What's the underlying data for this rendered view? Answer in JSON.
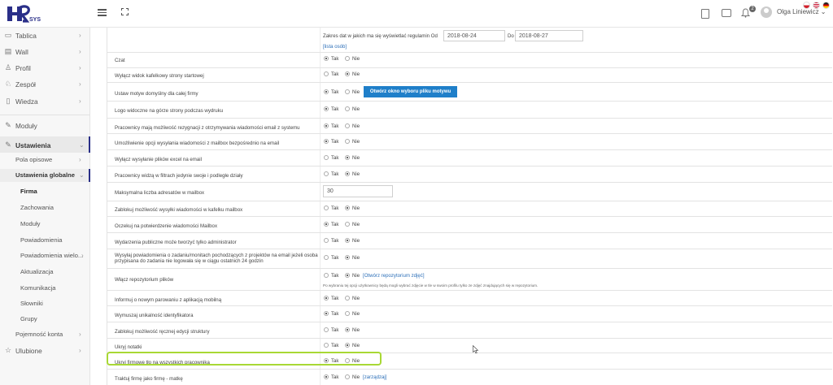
{
  "header": {
    "logo": "HR SYS",
    "user_name": "Olga Liniewicz ⌄",
    "notification_count": "2"
  },
  "sidebar": {
    "items": [
      {
        "label": "Tablica",
        "icon": "monitor-icon"
      },
      {
        "label": "Wall",
        "icon": "wall-icon"
      },
      {
        "label": "Profil",
        "icon": "user-icon"
      },
      {
        "label": "Zespół",
        "icon": "team-icon"
      },
      {
        "label": "Wiedza",
        "icon": "book-icon"
      },
      {
        "label": "Moduły",
        "icon": "wrench-icon"
      },
      {
        "label": "Ustawienia",
        "icon": "settings-icon"
      }
    ],
    "sub": {
      "pola_opisowe": "Pola opisowe",
      "ustawienia_globalne": "Ustawienia globalne",
      "firma": "Firma",
      "zachowania": "Zachowania",
      "moduly": "Moduły",
      "powiadomienia": "Powiadomienia",
      "powiadomienia_wielo": "Powiadomienia wielo...",
      "aktualizacja": "Aktualizacja",
      "komunikacja": "Komunikacja",
      "slowniki": "Słowniki",
      "grupy": "Grupy",
      "pojemnosc": "Pojemność konta",
      "ulubione": "Ulubione"
    }
  },
  "top_section": {
    "date_label": "Zakres dat w jakich ma się wyświetlać regulamin Od",
    "date_from": "2018-08-24",
    "do_label": "Do",
    "date_to": "2018-08-27",
    "lista_link": "[lista osób]"
  },
  "common": {
    "tak": "Tak",
    "nie": "Nie"
  },
  "rows": [
    {
      "label": "Czat",
      "value": "tak"
    },
    {
      "label": "Wyłącz widok kafelkowy strony startowej",
      "value": "nie"
    },
    {
      "label": "Ustaw motyw domyślny dla całej firmy",
      "value": "tak",
      "button": "Otwórz okno wyboru pliku motywu"
    },
    {
      "label": "Logo widoczne na górze strony podczas wydruku",
      "value": "tak"
    },
    {
      "label": "Pracownicy mają możliwość rezygnacji z otrzymywania wiadomości email z systemu",
      "value": "tak"
    },
    {
      "label": "Umożliwienie opcji wysyłania wiadomości z mailbox bezpośrednio na email",
      "value": "tak"
    },
    {
      "label": "Wyłącz wysyłanie plików excel na email",
      "value": "nie"
    },
    {
      "label": "Pracownicy widzą w filtrach jedynie swoje i podległe działy",
      "value": "nie"
    },
    {
      "label": "Maksymalna liczba adresatów w mailbox",
      "input": "30"
    },
    {
      "label": "Zablokuj możliwość wysyłki wiadomości w kafelku mailbox",
      "value": "nie"
    },
    {
      "label": "Oczekuj na potwierdzenie wiadomości Mailbox",
      "value": "tak"
    },
    {
      "label": "Wydarzenia publiczne może tworzyć tylko administrator",
      "value": "nie"
    },
    {
      "label": "Wysyłaj powiadomienia o zadaniu/monitach pochodzących z projektów na email jeżeli osoba",
      "label2": "przypisana do zadania nie logowała się w ciągu ostatnich 24 godzin",
      "value": "nie"
    },
    {
      "label": "Włącz repozytorium plików",
      "value": "nie",
      "link": "[Otwórz repozytorium zdjęć]",
      "note": "Po wybraniu tej opcji użytkownicy będą mogli wybrać zdjęcie w tle w swoim profilu tylko ze zdjęć znajdujących się w repozytorium."
    },
    {
      "label": "Informuj o nowym parowaniu z aplikacją mobilną",
      "value": "tak"
    },
    {
      "label": "Wymuszaj unikalność identyfikatora",
      "value": "tak"
    },
    {
      "label": "Zablokuj możliwość ręcznej edycji struktury",
      "value": "nie"
    },
    {
      "label": "Ukryj notatki",
      "value": "nie"
    },
    {
      "label": "Ukryj firmowe tło na wszystkich pracownika",
      "value": "tak"
    },
    {
      "label": "Traktuj firmę jako firmę - matkę",
      "value": "tak",
      "link": "[zarządzaj]"
    }
  ],
  "colors": {
    "accent": "#1f7fc9",
    "highlight": "#a8d834",
    "brand": "#2a2f88"
  }
}
